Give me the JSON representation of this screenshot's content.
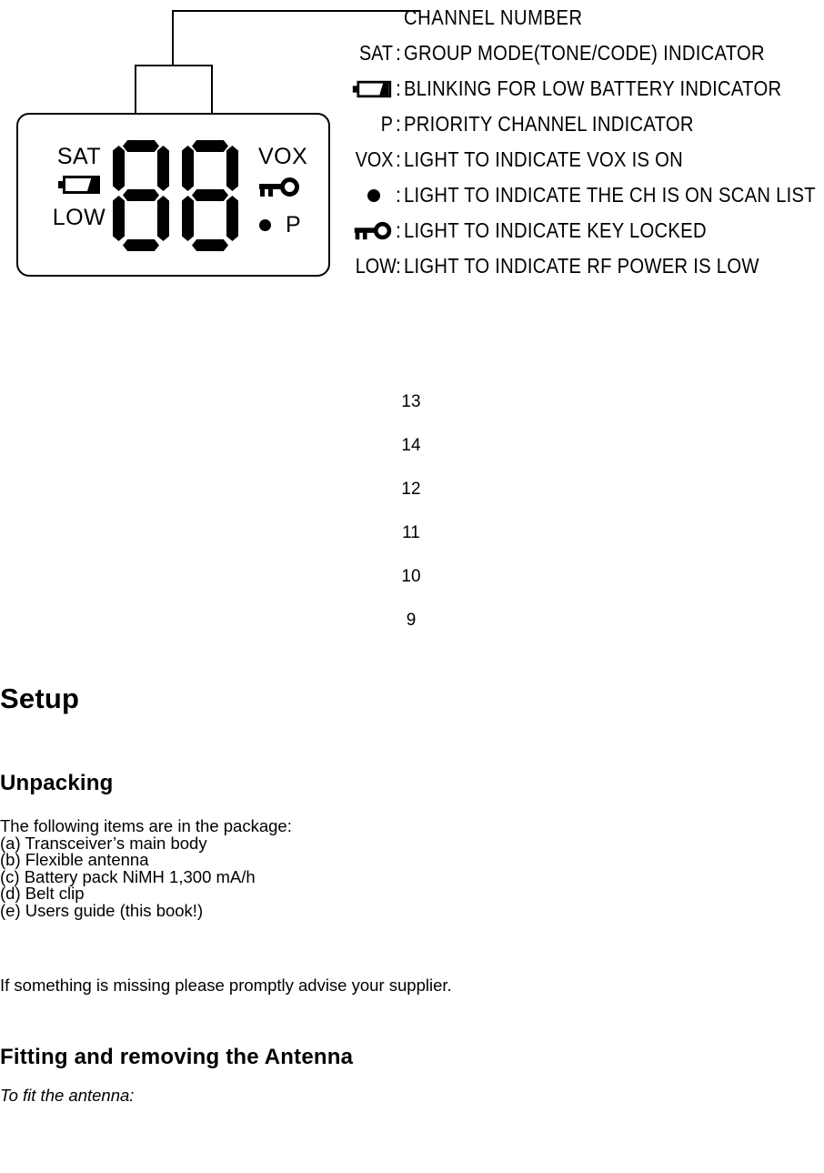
{
  "figure": {
    "lcd": {
      "left_indicators": {
        "sat_label": "SAT",
        "battery_icon": "low-battery-icon",
        "low_label": "LOW"
      },
      "channel_digits": "88",
      "right_indicators": {
        "vox_label": "VOX",
        "key_icon": "key-lock-icon",
        "scan_dot_icon": "scan-list-dot-icon",
        "priority_label": "P"
      }
    },
    "legend": [
      {
        "symbol": "",
        "symbol_icon": "",
        "colon": "",
        "description": "CHANNEL NUMBER"
      },
      {
        "symbol": "SAT",
        "symbol_icon": "",
        "colon": ":",
        "description": "GROUP  MODE(TONE/CODE)  INDICATOR"
      },
      {
        "symbol": "",
        "symbol_icon": "low-battery-icon",
        "colon": ":",
        "description": "BLINKING FOR LOW BATTERY INDICATOR"
      },
      {
        "symbol": "P",
        "symbol_icon": "",
        "colon": ":",
        "description": "PRIORITY CHANNEL  INDICATOR"
      },
      {
        "symbol": "VOX",
        "symbol_icon": "",
        "colon": ":",
        "description": "LIGHT  TO  INDICATE  VOX  IS  ON"
      },
      {
        "symbol": "",
        "symbol_icon": "scan-list-dot-icon",
        "colon": ":",
        "description": "LIGHT  TO  INDICATE  THE  CH  IS  ON  SCAN  LIST"
      },
      {
        "symbol": "",
        "symbol_icon": "key-lock-icon",
        "colon": ":",
        "description": "LIGHT  TO  INDICATE  KEY LOCKED"
      },
      {
        "symbol": "LOW",
        "symbol_icon": "",
        "colon": ":",
        "description": "LIGHT  TO  INDICATE  RF  POWER  IS  LOW"
      }
    ]
  },
  "page_numbers": [
    "13",
    "14",
    "12",
    "11",
    "10",
    "9"
  ],
  "document": {
    "heading_setup": "Setup",
    "heading_unpacking": "Unpacking",
    "para_following": "The following items are in the package:",
    "package_items": [
      "(a) Transceiver’s main body",
      "(b) Flexible antenna",
      "(c) Battery pack NiMH 1,300 mA/h",
      "(d) Belt clip",
      "(e) Users guide (this book!)"
    ],
    "para_missing": "If something is missing please promptly advise your supplier.",
    "heading_fitting": "Fitting and removing the Antenna",
    "para_to_fit": "To fit the antenna:"
  }
}
